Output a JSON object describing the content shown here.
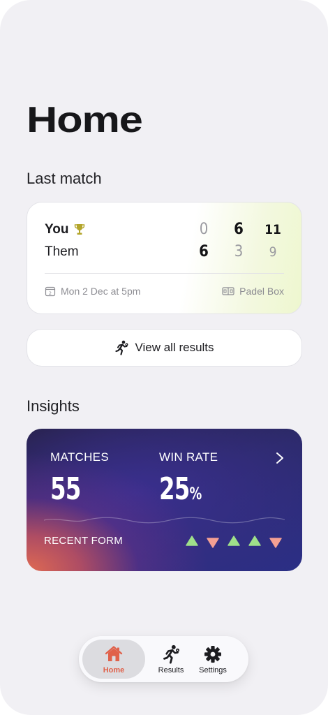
{
  "page": {
    "title": "Home"
  },
  "last_match": {
    "section_title": "Last match",
    "teams": [
      {
        "name": "You",
        "winner": true,
        "sets": [
          0,
          6,
          11
        ]
      },
      {
        "name": "Them",
        "winner": false,
        "sets": [
          6,
          3,
          9
        ]
      }
    ],
    "date": "Mon 2 Dec at 5pm",
    "date_icon_day": "2",
    "venue": "Padel Box"
  },
  "view_all": {
    "label": "View all results"
  },
  "insights": {
    "section_title": "Insights",
    "matches_label": "MATCHES",
    "matches_value": "55",
    "winrate_label": "WIN RATE",
    "winrate_value": "25",
    "winrate_unit": "%",
    "recent_form_label": "RECENT FORM",
    "recent_form": [
      "win",
      "loss",
      "win",
      "win",
      "loss"
    ]
  },
  "tabs": [
    {
      "label": "Home",
      "icon": "home-icon",
      "active": true
    },
    {
      "label": "Results",
      "icon": "running-figure-icon",
      "active": false
    },
    {
      "label": "Settings",
      "icon": "gear-icon",
      "active": false
    }
  ],
  "colors": {
    "background": "#f1f0f4",
    "accent": "#e0614a",
    "win": "#9fe08a",
    "loss": "#f4a093",
    "trophy": "#b3a52a"
  }
}
